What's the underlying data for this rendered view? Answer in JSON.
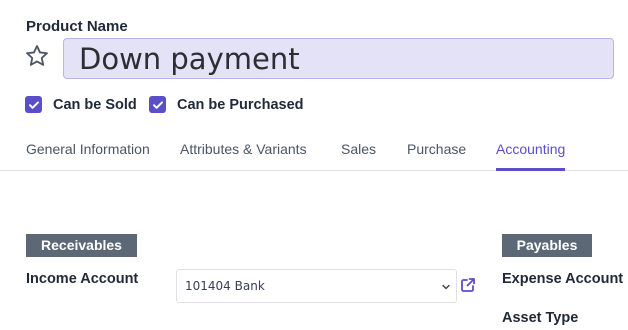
{
  "form": {
    "product_name_label": "Product Name",
    "product_name_value": "Down payment",
    "checkboxes": [
      {
        "label": "Can be Sold",
        "checked": true
      },
      {
        "label": "Can be Purchased",
        "checked": true
      }
    ]
  },
  "tabs": [
    {
      "label": "General Information",
      "active": false
    },
    {
      "label": "Attributes & Variants",
      "active": false
    },
    {
      "label": "Sales",
      "active": false
    },
    {
      "label": "Purchase",
      "active": false
    },
    {
      "label": "Accounting",
      "active": true
    }
  ],
  "receivables": {
    "header": "Receivables",
    "income_account_label": "Income Account",
    "income_account_value": "101404 Bank"
  },
  "payables": {
    "header": "Payables",
    "expense_account_label": "Expense Account",
    "asset_type_label": "Asset Type"
  },
  "icons": {
    "favorite": "star-icon",
    "checkbox": "check-icon",
    "dropdown": "chevron-down-icon",
    "external": "external-link-icon"
  },
  "colors": {
    "accent": "#5a4fc9",
    "input_bg": "#e3e2f7",
    "section_header_bg": "#5d6877"
  }
}
